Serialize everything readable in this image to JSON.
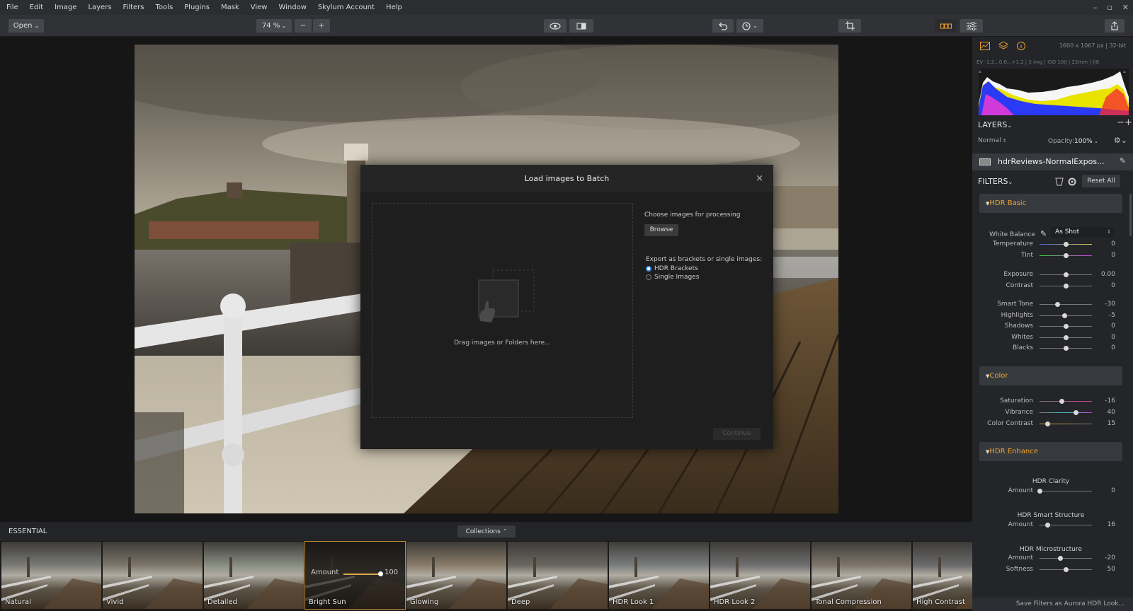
{
  "menu": [
    "File",
    "Edit",
    "Image",
    "Layers",
    "Filters",
    "Tools",
    "Plugins",
    "Mask",
    "View",
    "Window",
    "Skylum Account",
    "Help"
  ],
  "toolbar": {
    "open_label": "Open",
    "zoom_label": "74 %"
  },
  "dialog": {
    "title": "Load images to Batch",
    "close": "×",
    "drop_text": "Drag images or Folders here...",
    "choose_label": "Choose images for processing",
    "browse_label": "Browse",
    "export_label": "Export as brackets or single images:",
    "options": [
      {
        "label": "HDR Brackets",
        "checked": true
      },
      {
        "label": "Single Images",
        "checked": false
      }
    ],
    "continue_label": "Continue"
  },
  "strip": {
    "section": "ESSENTIAL",
    "collections": "Collections",
    "amount_label": "Amount",
    "amount_value": 100,
    "amount_display": "100",
    "thumbs": [
      "Natural",
      "Vivid",
      "Detailed",
      "Bright Sun",
      "Glowing",
      "Deep",
      "HDR Look 1",
      "HDR Look 2",
      "Tonal Compression",
      "High Contrast"
    ]
  },
  "panel": {
    "image_info": "1600 x 1067 px  |  32-bit",
    "exif": "EV -1.2...0.0...+1.2  |  3 img  |  ISO 100  |  22mm  |  f/8",
    "layers_title": "LAYERS",
    "blend": "Normal",
    "opacity_label": "Opacity:",
    "opacity_value": "100%",
    "layer_name": "hdrReviews-NormalExpos...",
    "filters_title": "FILTERS",
    "reset_label": "Reset All",
    "hdr_basic": "HDR Basic",
    "wb_label": "White Balance",
    "wb_value": "As Shot",
    "basic_sliders": [
      {
        "label": "Temperature",
        "value": "0",
        "pos": 0.5
      },
      {
        "label": "Tint",
        "value": "0",
        "pos": 0.5
      },
      {
        "label": "Exposure",
        "value": "0.00",
        "pos": 0.5
      },
      {
        "label": "Contrast",
        "value": "0",
        "pos": 0.5
      },
      {
        "label": "Smart Tone",
        "value": "-30",
        "pos": 0.35
      },
      {
        "label": "Highlights",
        "value": "-5",
        "pos": 0.475
      },
      {
        "label": "Shadows",
        "value": "0",
        "pos": 0.5
      },
      {
        "label": "Whites",
        "value": "0",
        "pos": 0.5
      },
      {
        "label": "Blacks",
        "value": "0",
        "pos": 0.5
      }
    ],
    "color_title": "Color",
    "color_sliders": [
      {
        "label": "Saturation",
        "value": "-16",
        "pos": 0.42
      },
      {
        "label": "Vibrance",
        "value": "40",
        "pos": 0.7
      },
      {
        "label": "Color Contrast",
        "value": "15",
        "pos": 0.15
      }
    ],
    "enhance_title": "HDR Enhance",
    "clarity_title": "HDR Clarity",
    "clarity_amount": {
      "label": "Amount",
      "value": "0",
      "pos": 0.0
    },
    "structure_title": "HDR Smart Structure",
    "structure_amount": {
      "label": "Amount",
      "value": "16",
      "pos": 0.16
    },
    "micro_title": "HDR Microstructure",
    "micro_sliders": [
      {
        "label": "Amount",
        "value": "-20",
        "pos": 0.4
      },
      {
        "label": "Softness",
        "value": "50",
        "pos": 0.5
      }
    ],
    "save_label": "Save Filters as Aurora HDR Look..."
  }
}
